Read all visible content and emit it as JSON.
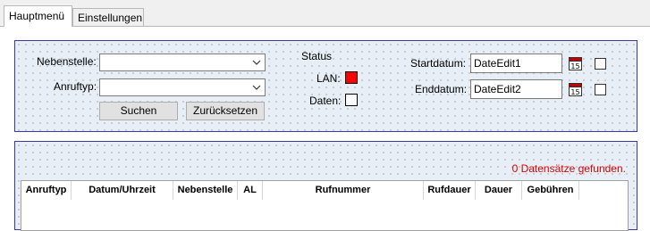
{
  "tabs": [
    {
      "label": "Hauptmenü",
      "active": true
    },
    {
      "label": "Einstellungen",
      "active": false
    }
  ],
  "filter": {
    "nebenstelle_label": "Nebenstelle:",
    "nebenstelle_value": "",
    "anruftyp_label": "Anruftyp:",
    "anruftyp_value": "",
    "search_button": "Suchen",
    "reset_button": "Zurücksetzen",
    "status_label": "Status",
    "lan_label": "LAN:",
    "daten_label": "Daten:",
    "start_label": "Startdatum:",
    "start_value": "DateEdit1",
    "end_label": "Enddatum:",
    "end_value": "DateEdit2",
    "calendar_day": "15",
    "start_checked": false,
    "end_checked": false
  },
  "status_colors": {
    "lan": "#ff0000",
    "daten": "#ffffff"
  },
  "results": {
    "count_text": "0 Datensätze gefunden.",
    "columns": [
      "Anruftyp",
      "Datum/Uhrzeit",
      "Nebenstelle",
      "AL",
      "Rufnummer",
      "Rufdauer",
      "Dauer",
      "Gebühren"
    ],
    "rows": []
  }
}
